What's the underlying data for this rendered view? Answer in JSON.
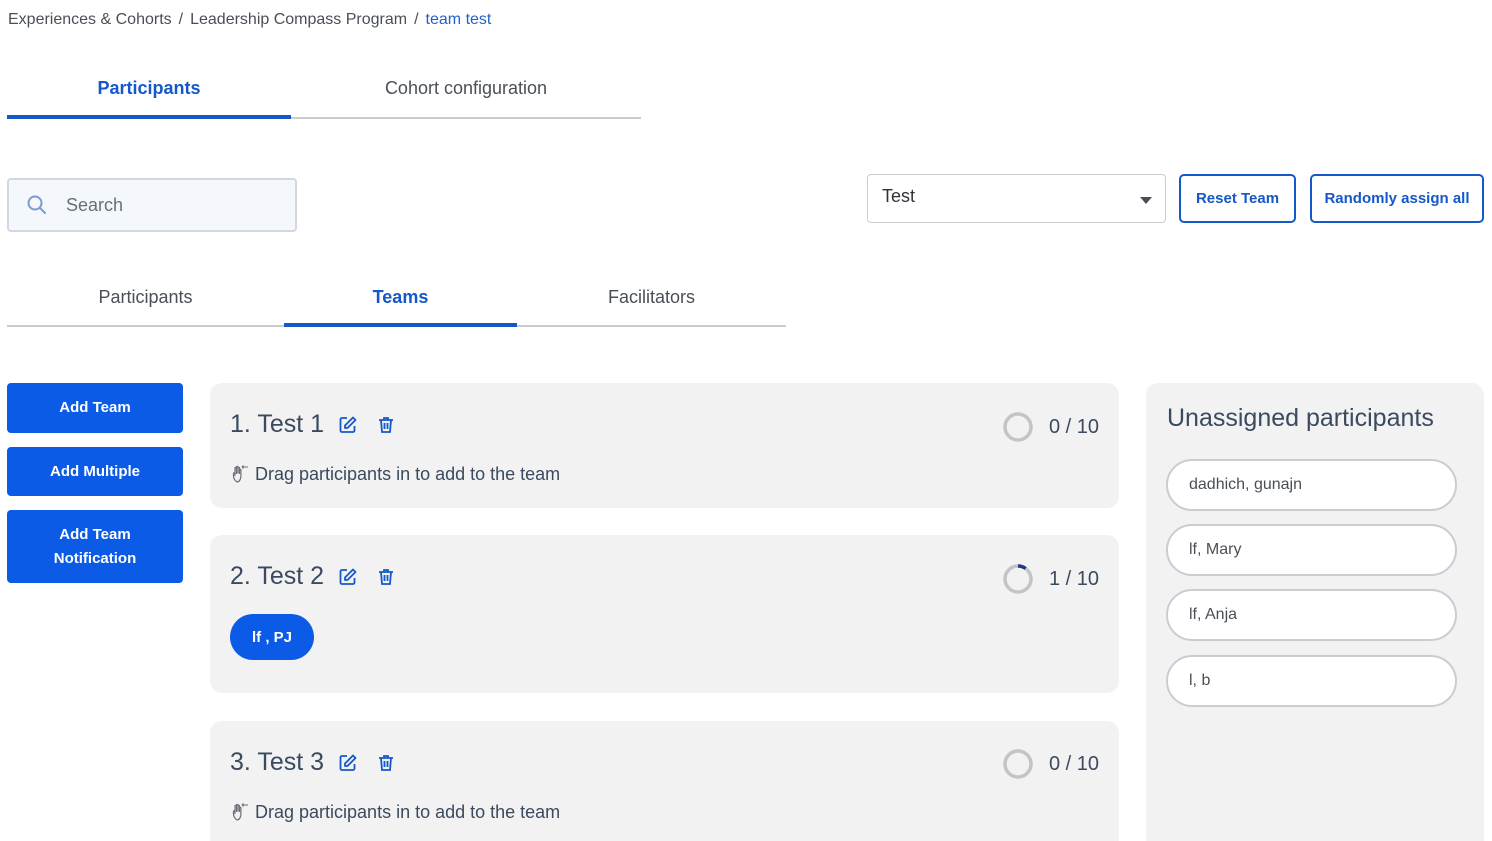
{
  "breadcrumb": {
    "item1": "Experiences & Cohorts",
    "item2": "Leadership Compass Program",
    "current": "team test",
    "separator": "/"
  },
  "top_tabs": {
    "participants": "Participants",
    "cohort_config": "Cohort configuration"
  },
  "search": {
    "placeholder": "Search",
    "value": ""
  },
  "team_select": {
    "value": "Test"
  },
  "buttons": {
    "reset_team": "Reset Team",
    "randomly_assign": "Randomly assign all",
    "add_team": "Add Team",
    "add_multiple": "Add Multiple",
    "add_team_notification_line1": "Add Team",
    "add_team_notification_line2": "Notification"
  },
  "sub_tabs": {
    "participants": "Participants",
    "teams": "Teams",
    "facilitators": "Facilitators"
  },
  "teams": [
    {
      "title": "1. Test 1",
      "count": "0 / 10",
      "fill": 0.0,
      "hint": "Drag participants in to add to the team",
      "members": []
    },
    {
      "title": "2. Test 2",
      "count": "1 / 10",
      "fill": 0.1,
      "hint": "",
      "members": [
        "lf , PJ"
      ]
    },
    {
      "title": "3. Test 3",
      "count": "0 / 10",
      "fill": 0.0,
      "hint": "Drag participants in to add to the team",
      "members": []
    }
  ],
  "unassigned": {
    "title": "Unassigned participants",
    "participants": [
      "dadhich, gunajn",
      "lf, Mary",
      "lf, Anja",
      "l, b"
    ]
  },
  "colors": {
    "primary": "#0c5be6",
    "accent_text": "#1458c9",
    "card_bg": "#f2f2f3",
    "progress_track": "#c2c4c8",
    "progress_fill": "#1f3a8a"
  },
  "icons": {
    "search": "search-icon",
    "edit": "edit-icon",
    "delete": "trash-icon",
    "drag": "drag-hand-icon",
    "progress": "progress-ring-icon",
    "dropdown": "chevron-down-icon"
  }
}
